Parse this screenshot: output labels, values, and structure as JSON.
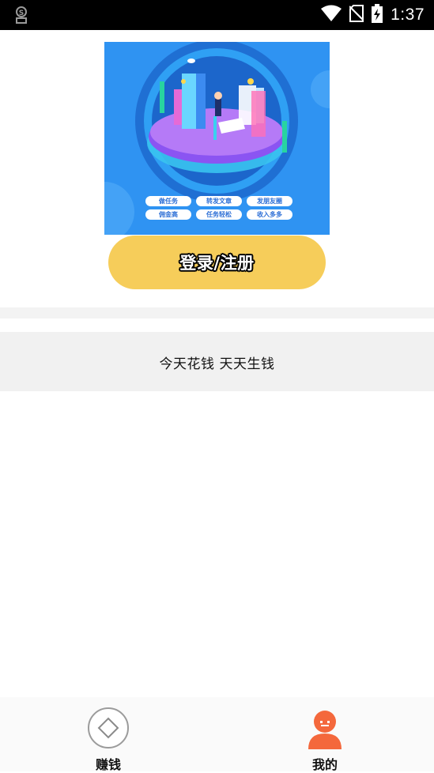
{
  "status_bar": {
    "time": "1:37",
    "icons": [
      "notification-app-icon",
      "wifi-icon",
      "no-sim-icon",
      "battery-charging-icon"
    ]
  },
  "banner": {
    "tags": [
      "做任务",
      "转发文章",
      "发朋友圈",
      "佣金高",
      "任务轻松",
      "收入多多"
    ]
  },
  "login_button": {
    "label": "登录/注册"
  },
  "slogan": "今天花钱 天天生钱",
  "bottom_nav": {
    "items": [
      {
        "label": "赚钱",
        "icon": "diamond-icon"
      },
      {
        "label": "我的",
        "icon": "profile-face-icon",
        "active_color": "#f4683c"
      }
    ]
  }
}
